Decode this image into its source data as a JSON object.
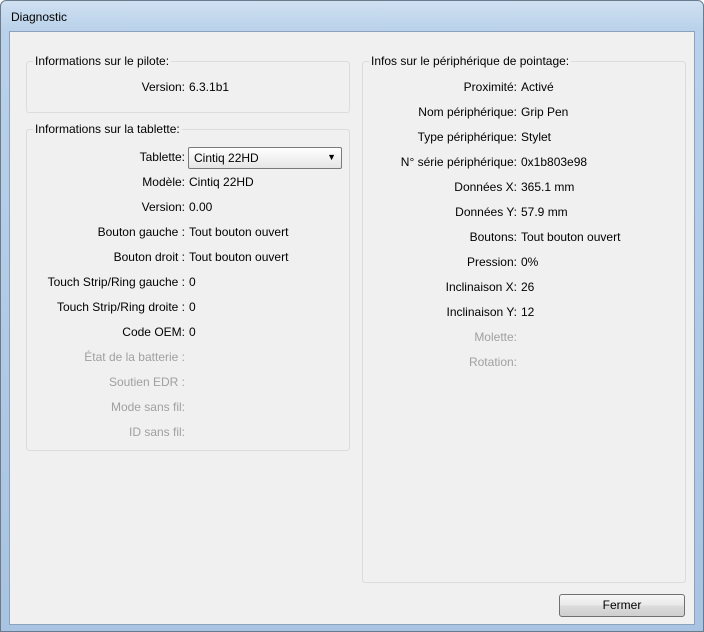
{
  "window": {
    "title": "Diagnostic"
  },
  "driver_info": {
    "group_label": "Informations sur le pilote:",
    "version_label": "Version:",
    "version_value": "6.3.1b1"
  },
  "tablet_info": {
    "group_label": "Informations sur la tablette:",
    "tablet_label": "Tablette:",
    "tablet_selected": "Cintiq 22HD",
    "rows": [
      {
        "label": "Modèle:",
        "value": "Cintiq 22HD",
        "disabled": false
      },
      {
        "label": "Version:",
        "value": "0.00",
        "disabled": false
      },
      {
        "label": "Bouton gauche :",
        "value": "Tout bouton ouvert",
        "disabled": false
      },
      {
        "label": "Bouton droit :",
        "value": "Tout bouton ouvert",
        "disabled": false
      },
      {
        "label": "Touch Strip/Ring gauche :",
        "value": "0",
        "disabled": false
      },
      {
        "label": "Touch Strip/Ring droite :",
        "value": "0",
        "disabled": false
      },
      {
        "label": "Code OEM:",
        "value": "0",
        "disabled": false
      },
      {
        "label": "État de la batterie :",
        "value": "",
        "disabled": true
      },
      {
        "label": "Soutien EDR :",
        "value": "",
        "disabled": true
      },
      {
        "label": "Mode sans fil:",
        "value": "",
        "disabled": true
      },
      {
        "label": "ID sans fil:",
        "value": "",
        "disabled": true
      }
    ]
  },
  "pointer_info": {
    "group_label": "Infos sur le périphérique de pointage:",
    "rows": [
      {
        "label": "Proximité:",
        "value": "Activé",
        "disabled": false
      },
      {
        "label": "Nom périphérique:",
        "value": "Grip Pen",
        "disabled": false
      },
      {
        "label": "Type périphérique:",
        "value": "Stylet",
        "disabled": false
      },
      {
        "label": "N° série périphérique:",
        "value": "0x1b803e98",
        "disabled": false
      },
      {
        "label": "Données X:",
        "value": "365.1 mm",
        "disabled": false
      },
      {
        "label": "Données Y:",
        "value": "57.9 mm",
        "disabled": false
      },
      {
        "label": "Boutons:",
        "value": "Tout bouton ouvert",
        "disabled": false
      },
      {
        "label": "Pression:",
        "value": "0%",
        "disabled": false
      },
      {
        "label": "Inclinaison X:",
        "value": "26",
        "disabled": false
      },
      {
        "label": "Inclinaison Y:",
        "value": "12",
        "disabled": false
      },
      {
        "label": "Molette:",
        "value": "",
        "disabled": true
      },
      {
        "label": "Rotation:",
        "value": "",
        "disabled": true
      }
    ]
  },
  "buttons": {
    "close_label": "Fermer"
  }
}
